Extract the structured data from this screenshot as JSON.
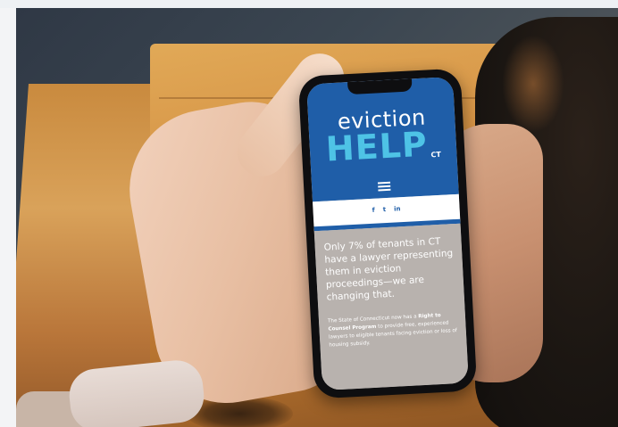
{
  "scene": {
    "description_colors": {
      "background_top": "#eef1f4",
      "wood": "#d69446",
      "phone_body": "#0e0e10",
      "brand_blue": "#1f5ea8",
      "brand_cyan": "#4ec3e6",
      "panel_gray": "#b8b2ae"
    }
  },
  "phone_screen": {
    "logo": {
      "word_top": "eviction",
      "word_main": "HELP",
      "suffix": "CT"
    },
    "menu_icon": "hamburger-menu-icon",
    "social": {
      "facebook": "f",
      "twitter": "t",
      "linkedin": "in"
    },
    "headline": "Only 7% of tenants in CT have a lawyer representing them in eviction proceedings—we are changing that.",
    "subtext_intro": "The State of Connecticut now has a ",
    "subtext_bold": "Right to Counsel Program",
    "subtext_rest": " to provide free, experienced lawyers to eligible tenants facing eviction or loss of housing subsidy."
  }
}
